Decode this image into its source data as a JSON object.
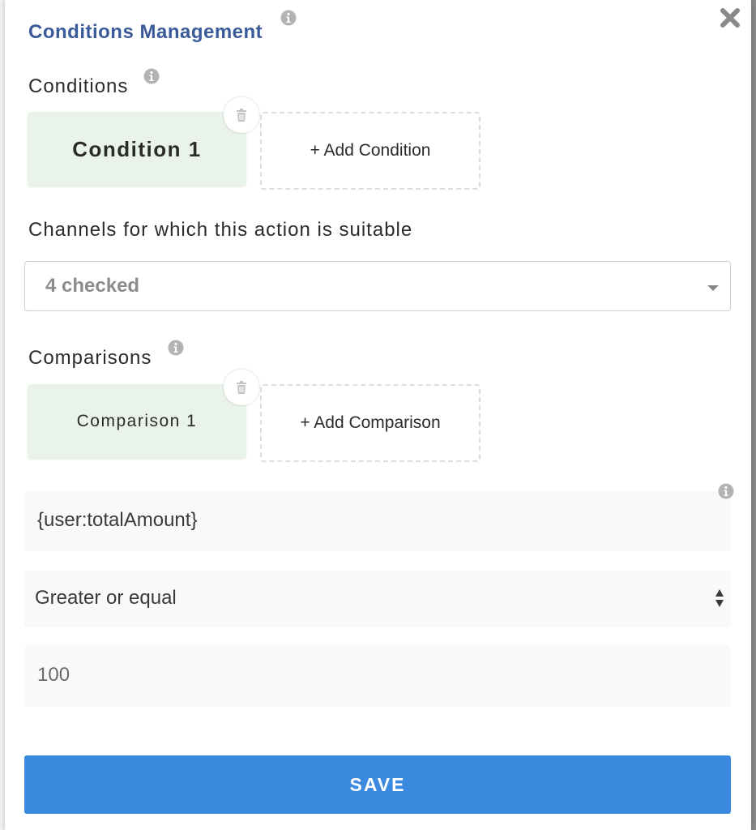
{
  "modal": {
    "title": "Conditions Management",
    "close_icon": "close-icon"
  },
  "conditions": {
    "label": "Conditions",
    "items": [
      {
        "label": "Condition 1"
      }
    ],
    "add_label": "+ Add Condition"
  },
  "channels": {
    "label": "Channels for which this action is suitable",
    "value": "4 checked"
  },
  "comparisons": {
    "label": "Comparisons",
    "items": [
      {
        "label": "Comparison 1"
      }
    ],
    "add_label": "+ Add Comparison"
  },
  "comparison_form": {
    "variable_value": "{user:totalAmount}",
    "operator_value": "Greater or equal",
    "compare_value": "100"
  },
  "actions": {
    "save_label": "SAVE"
  },
  "colors": {
    "title": "#3a5a9a",
    "card_bg": "#e9f3ea",
    "save_bg": "#3b8ae0"
  }
}
